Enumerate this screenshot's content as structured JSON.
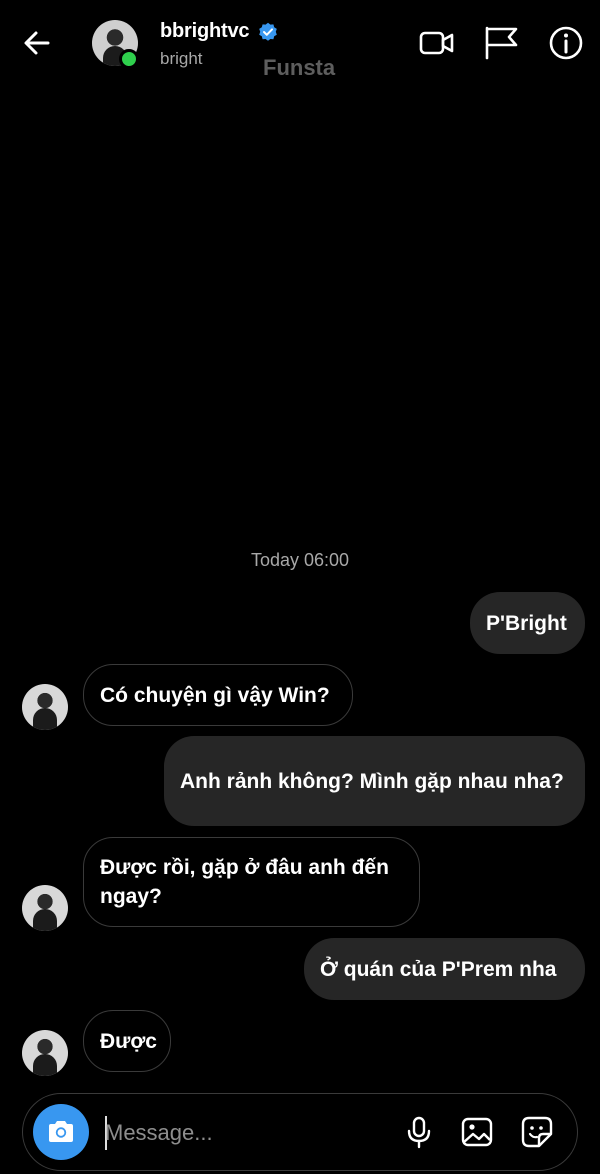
{
  "header": {
    "username": "bbrightvc",
    "subname": "bright",
    "watermark": "Funsta"
  },
  "conversation": {
    "timestamp": "Today 06:00",
    "messages": [
      {
        "direction": "out",
        "text": "P'Bright"
      },
      {
        "direction": "in",
        "text": "Có chuyện gì vậy Win?"
      },
      {
        "direction": "out",
        "text": "Anh rảnh không? Mình gặp nhau nha?"
      },
      {
        "direction": "in",
        "text": "Được rồi, gặp ở đâu anh đến ngay?"
      },
      {
        "direction": "out",
        "text": "Ở quán của P'Prem nha"
      },
      {
        "direction": "in",
        "text": "Được"
      }
    ]
  },
  "composer": {
    "placeholder": "Message..."
  },
  "colors": {
    "background": "#000000",
    "outgoing_bubble": "#262626",
    "incoming_border": "#3a3a3a",
    "accent_blue": "#3897f0",
    "online_green": "#2fd04d",
    "secondary_text": "#a8a8a8"
  },
  "icons": [
    "back-arrow-icon",
    "verified-badge-icon",
    "video-call-icon",
    "flag-icon",
    "info-icon",
    "camera-icon",
    "microphone-icon",
    "gallery-icon",
    "sticker-icon"
  ]
}
